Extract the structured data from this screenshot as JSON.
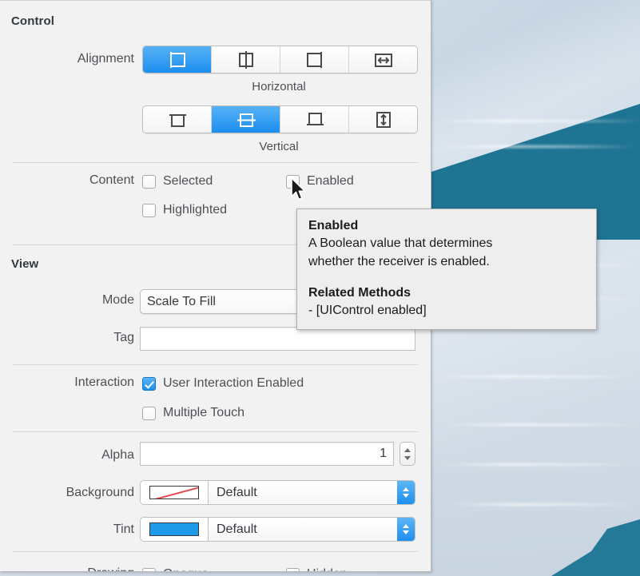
{
  "window": {
    "panel_name": "attributes-inspector"
  },
  "control_section": {
    "title": "Control",
    "alignment": {
      "label": "Alignment",
      "horizontal": {
        "caption": "Horizontal",
        "selected_index": 0,
        "options": [
          "align-left-icon",
          "align-center-horizontal-icon",
          "align-right-icon",
          "align-fill-horizontal-icon"
        ]
      },
      "vertical": {
        "caption": "Vertical",
        "selected_index": 1,
        "options": [
          "align-top-icon",
          "align-center-vertical-icon",
          "align-bottom-icon",
          "align-fill-vertical-icon"
        ]
      }
    },
    "content": {
      "label": "Content",
      "checkboxes": [
        {
          "label": "Selected",
          "checked": false
        },
        {
          "label": "Enabled",
          "checked": false
        },
        {
          "label": "Highlighted",
          "checked": false
        }
      ]
    }
  },
  "view_section": {
    "title": "View",
    "mode": {
      "label": "Mode",
      "value": "Scale To Fill"
    },
    "tag": {
      "label": "Tag",
      "value": "",
      "placeholder": ""
    },
    "interaction": {
      "label": "Interaction",
      "checkboxes": [
        {
          "label": "User Interaction Enabled",
          "checked": true
        },
        {
          "label": "Multiple Touch",
          "checked": false
        }
      ]
    },
    "alpha": {
      "label": "Alpha",
      "value": "1"
    },
    "background": {
      "label": "Background",
      "value": "Default",
      "swatch": "none",
      "swatch_color": "#ffffff"
    },
    "tint": {
      "label": "Tint",
      "value": "Default",
      "swatch": "color",
      "swatch_color": "#1e9ae8"
    }
  },
  "tooltip": {
    "title": "Enabled",
    "description_line1": "A Boolean value that determines",
    "description_line2": "whether the receiver is enabled.",
    "related_heading": "Related Methods",
    "related_method": "- [UIControl enabled]"
  },
  "cursor": {
    "type": "arrow-pointer"
  },
  "colors": {
    "accent_blue": "#1e8fef",
    "panel_bg": "#f2f2f2",
    "tooltip_bg": "#efeeee",
    "water_blue": "#18718f"
  }
}
